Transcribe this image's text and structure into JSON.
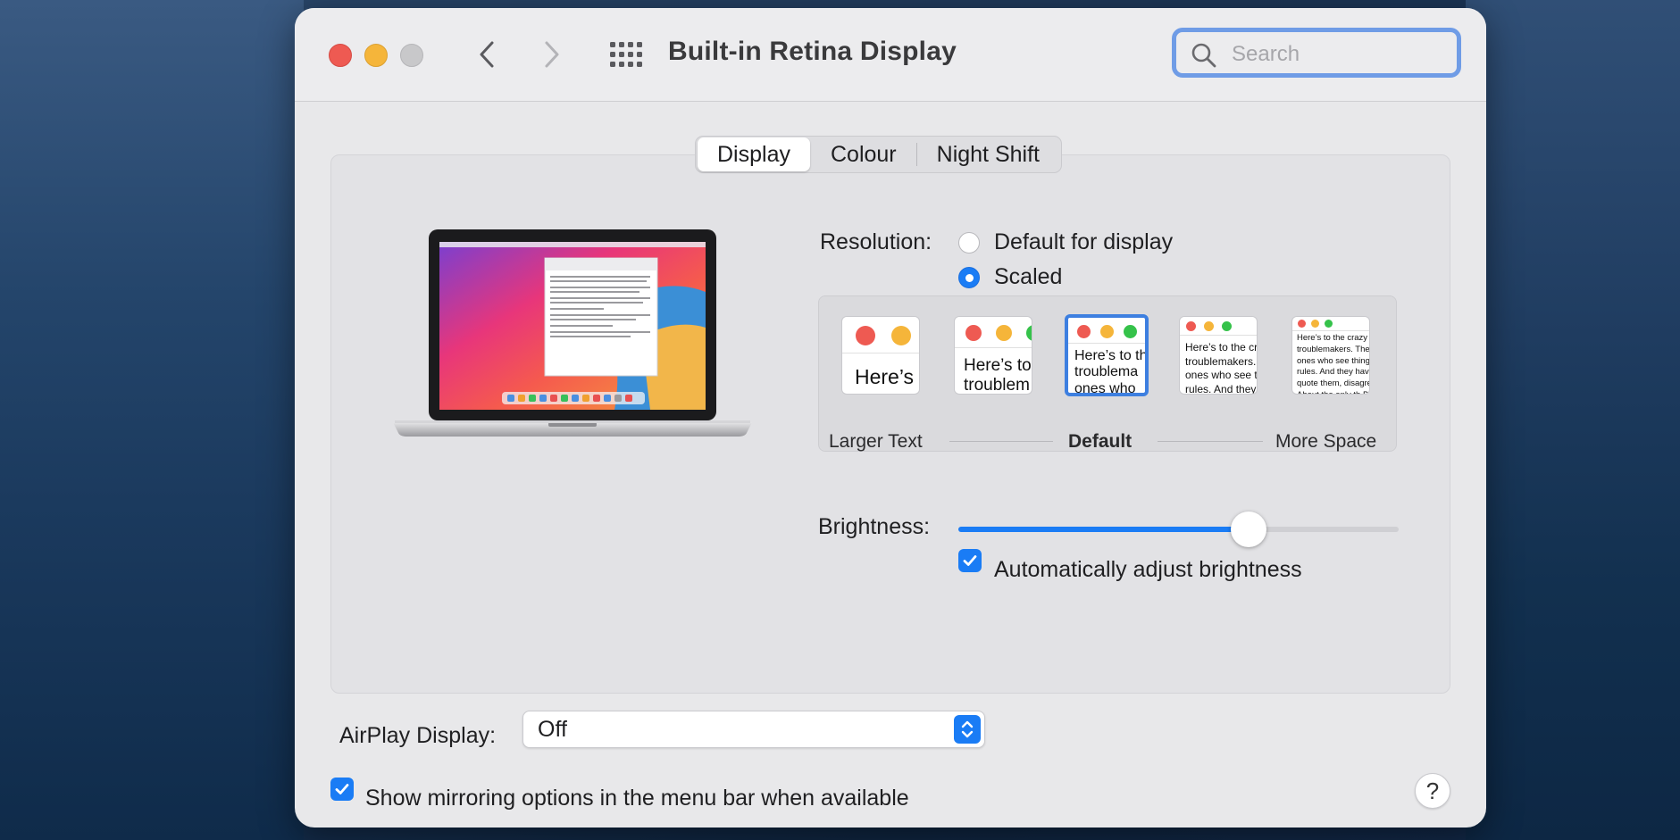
{
  "window": {
    "title": "Built-in Retina Display"
  },
  "search": {
    "placeholder": "Search"
  },
  "tabs": [
    {
      "label": "Display",
      "active": true
    },
    {
      "label": "Colour",
      "active": false
    },
    {
      "label": "Night Shift",
      "active": false
    }
  ],
  "resolution": {
    "label": "Resolution:",
    "options": [
      {
        "label": "Default for display",
        "selected": false
      },
      {
        "label": "Scaled",
        "selected": true
      }
    ]
  },
  "scaled_options": {
    "thumbnails": [
      {
        "text": "Here’s",
        "selected": false
      },
      {
        "text": "Here’s to the troublem",
        "selected": false
      },
      {
        "text": "Here’s to the troublema ones who",
        "selected": true
      },
      {
        "text": "Here’s to the crazy troublemakers. The ones who see t rules. And they",
        "selected": false
      },
      {
        "text": "Here’s to the crazy ones troublemakers. The rou ones who see things di rules. And they have no can quote them, disagre them. About the only th Because they change t",
        "selected": false
      }
    ],
    "labels": {
      "left": "Larger Text",
      "center": "Default",
      "right": "More Space"
    }
  },
  "brightness": {
    "label": "Brightness:",
    "value_percent": 66
  },
  "auto_brightness": {
    "label": "Automatically adjust brightness",
    "checked": true
  },
  "airplay": {
    "label": "AirPlay Display:",
    "value": "Off"
  },
  "mirroring": {
    "label": "Show mirroring options in the menu bar when available",
    "checked": true
  },
  "help": {
    "label": "?"
  },
  "colors": {
    "accent": "#1a7cf5",
    "close": "#ee5a52",
    "minimize": "#f5b53a",
    "zoom_disabled": "#c8c8ca",
    "thumb_green": "#35c24a"
  }
}
